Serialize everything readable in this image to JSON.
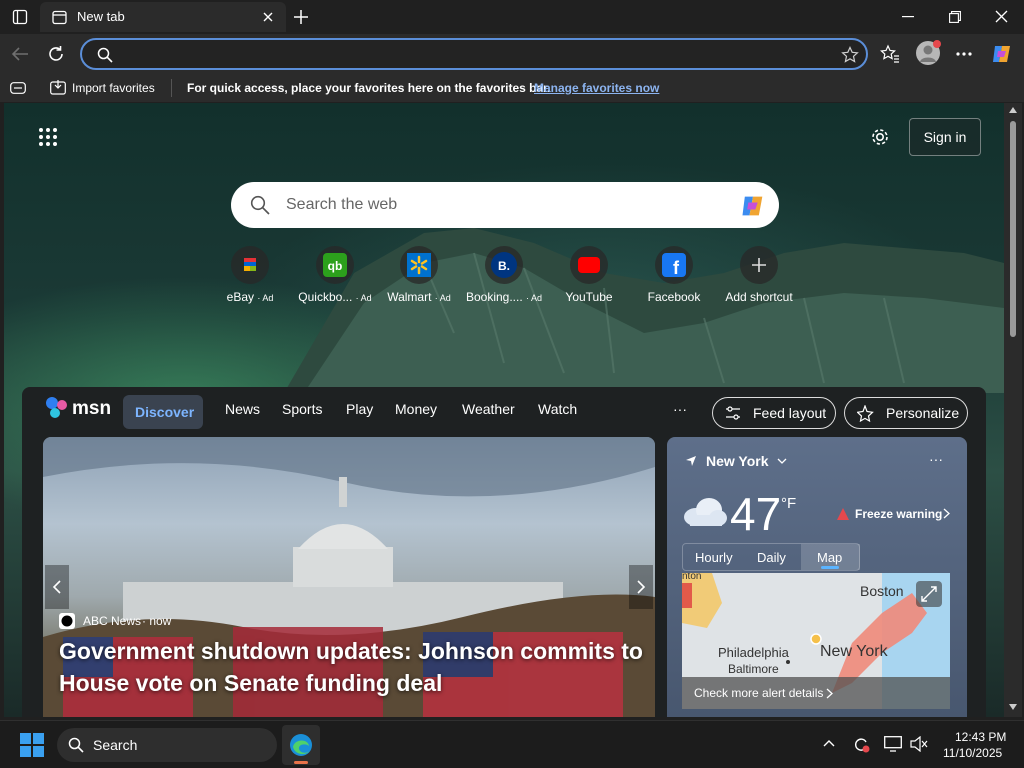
{
  "browser": {
    "tab_title": "New tab",
    "address_value": "",
    "favbar": {
      "import": "Import favorites",
      "message": "For quick access, place your favorites here on the favorites bar.",
      "manage_link": "Manage favorites now"
    }
  },
  "newtab": {
    "sign_in": "Sign in",
    "search_placeholder": "Search the web",
    "shortcuts": [
      {
        "label": "eBay",
        "ad": "· Ad",
        "icon": "ebay-icon"
      },
      {
        "label": "Quickbo...",
        "ad": "· Ad",
        "icon": "quickbooks-icon"
      },
      {
        "label": "Walmart",
        "ad": "· Ad",
        "icon": "walmart-icon"
      },
      {
        "label": "Booking....",
        "ad": "· Ad",
        "icon": "booking-icon"
      },
      {
        "label": "YouTube",
        "ad": "",
        "icon": "youtube-icon"
      },
      {
        "label": "Facebook",
        "ad": "",
        "icon": "facebook-icon"
      },
      {
        "label": "Add shortcut",
        "ad": "",
        "icon": "plus-icon"
      }
    ]
  },
  "msn": {
    "logo": "msn",
    "nav": [
      "Discover",
      "News",
      "Sports",
      "Play",
      "Money",
      "Weather",
      "Watch"
    ],
    "more": "···",
    "feed_layout": "Feed layout",
    "personalize": "Personalize",
    "hero": {
      "source": "ABC News",
      "time": "· now",
      "headline": "Government shutdown updates: Johnson commits to House vote on Senate funding deal"
    },
    "weather": {
      "location": "New York",
      "temp": "47",
      "unit": "°F",
      "alert": "Freeze warning",
      "tabs": [
        "Hourly",
        "Daily",
        "Map"
      ],
      "active_tab": "Map",
      "map_labels": {
        "boston": "Boston",
        "philadelphia": "Philadelphia",
        "baltimore": "Baltimore",
        "newyork": "New York",
        "top": "nton"
      },
      "alert_details": "Check more alert details"
    }
  },
  "taskbar": {
    "search": "Search",
    "time": "12:43 PM",
    "date": "11/10/2025"
  },
  "colors": {
    "accent": "#5b8ed8",
    "discover_bg": "#3a4350",
    "alert_red": "#e5484d"
  }
}
